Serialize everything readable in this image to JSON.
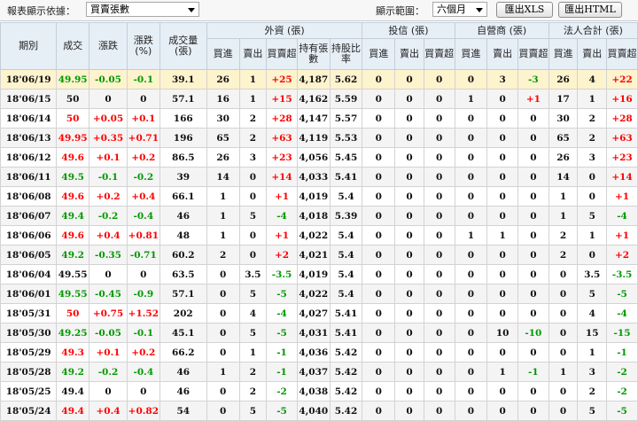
{
  "toolbar": {
    "display_basis_label": "報表顯示依據：",
    "display_basis_value": "買賣張數",
    "range_label": "顯示範圍：",
    "range_value": "六個月",
    "export_xls_label": "匯出XLS",
    "export_html_label": "匯出HTML"
  },
  "colors": {
    "up": "#ff0000",
    "down": "#009900",
    "highlight_row": "#fdf3cd",
    "header_bg": "#e6eef6"
  },
  "table": {
    "headers": {
      "date": "期別",
      "close": "成交",
      "change": "漲跌",
      "change_pct": "漲跌(%)",
      "volume": "成交量(張)",
      "foreign": "外資 (張)",
      "trust": "投信 (張)",
      "dealer": "自營商 (張)",
      "total": "法人合計 (張)",
      "buy": "買進",
      "sell": "賣出",
      "net": "買賣超",
      "holding": "持有張數",
      "ratio": "持股比率"
    },
    "rows": [
      {
        "date": "18'06/19",
        "close": "49.95",
        "change": "-0.05",
        "pct": "-0.1",
        "vol": "39.1",
        "f_buy": "26",
        "f_sell": "1",
        "f_net": "+25",
        "f_hold": "4,187",
        "f_ratio": "5.62",
        "t_buy": "0",
        "t_sell": "0",
        "t_net": "0",
        "d_buy": "0",
        "d_sell": "3",
        "d_net": "-3",
        "s_buy": "26",
        "s_sell": "4",
        "s_net": "+22"
      },
      {
        "date": "18'06/15",
        "close": "50",
        "change": "0",
        "pct": "0",
        "vol": "57.1",
        "f_buy": "16",
        "f_sell": "1",
        "f_net": "+15",
        "f_hold": "4,162",
        "f_ratio": "5.59",
        "t_buy": "0",
        "t_sell": "0",
        "t_net": "0",
        "d_buy": "1",
        "d_sell": "0",
        "d_net": "+1",
        "s_buy": "17",
        "s_sell": "1",
        "s_net": "+16"
      },
      {
        "date": "18'06/14",
        "close": "50",
        "change": "+0.05",
        "pct": "+0.1",
        "vol": "166",
        "f_buy": "30",
        "f_sell": "2",
        "f_net": "+28",
        "f_hold": "4,147",
        "f_ratio": "5.57",
        "t_buy": "0",
        "t_sell": "0",
        "t_net": "0",
        "d_buy": "0",
        "d_sell": "0",
        "d_net": "0",
        "s_buy": "30",
        "s_sell": "2",
        "s_net": "+28"
      },
      {
        "date": "18'06/13",
        "close": "49.95",
        "change": "+0.35",
        "pct": "+0.71",
        "vol": "196",
        "f_buy": "65",
        "f_sell": "2",
        "f_net": "+63",
        "f_hold": "4,119",
        "f_ratio": "5.53",
        "t_buy": "0",
        "t_sell": "0",
        "t_net": "0",
        "d_buy": "0",
        "d_sell": "0",
        "d_net": "0",
        "s_buy": "65",
        "s_sell": "2",
        "s_net": "+63"
      },
      {
        "date": "18'06/12",
        "close": "49.6",
        "change": "+0.1",
        "pct": "+0.2",
        "vol": "86.5",
        "f_buy": "26",
        "f_sell": "3",
        "f_net": "+23",
        "f_hold": "4,056",
        "f_ratio": "5.45",
        "t_buy": "0",
        "t_sell": "0",
        "t_net": "0",
        "d_buy": "0",
        "d_sell": "0",
        "d_net": "0",
        "s_buy": "26",
        "s_sell": "3",
        "s_net": "+23"
      },
      {
        "date": "18'06/11",
        "close": "49.5",
        "change": "-0.1",
        "pct": "-0.2",
        "vol": "39",
        "f_buy": "14",
        "f_sell": "0",
        "f_net": "+14",
        "f_hold": "4,033",
        "f_ratio": "5.41",
        "t_buy": "0",
        "t_sell": "0",
        "t_net": "0",
        "d_buy": "0",
        "d_sell": "0",
        "d_net": "0",
        "s_buy": "14",
        "s_sell": "0",
        "s_net": "+14"
      },
      {
        "date": "18'06/08",
        "close": "49.6",
        "change": "+0.2",
        "pct": "+0.4",
        "vol": "66.1",
        "f_buy": "1",
        "f_sell": "0",
        "f_net": "+1",
        "f_hold": "4,019",
        "f_ratio": "5.4",
        "t_buy": "0",
        "t_sell": "0",
        "t_net": "0",
        "d_buy": "0",
        "d_sell": "0",
        "d_net": "0",
        "s_buy": "1",
        "s_sell": "0",
        "s_net": "+1"
      },
      {
        "date": "18'06/07",
        "close": "49.4",
        "change": "-0.2",
        "pct": "-0.4",
        "vol": "46",
        "f_buy": "1",
        "f_sell": "5",
        "f_net": "-4",
        "f_hold": "4,018",
        "f_ratio": "5.39",
        "t_buy": "0",
        "t_sell": "0",
        "t_net": "0",
        "d_buy": "0",
        "d_sell": "0",
        "d_net": "0",
        "s_buy": "1",
        "s_sell": "5",
        "s_net": "-4"
      },
      {
        "date": "18'06/06",
        "close": "49.6",
        "change": "+0.4",
        "pct": "+0.81",
        "vol": "48",
        "f_buy": "1",
        "f_sell": "0",
        "f_net": "+1",
        "f_hold": "4,022",
        "f_ratio": "5.4",
        "t_buy": "0",
        "t_sell": "0",
        "t_net": "0",
        "d_buy": "1",
        "d_sell": "1",
        "d_net": "0",
        "s_buy": "2",
        "s_sell": "1",
        "s_net": "+1"
      },
      {
        "date": "18'06/05",
        "close": "49.2",
        "change": "-0.35",
        "pct": "-0.71",
        "vol": "60.2",
        "f_buy": "2",
        "f_sell": "0",
        "f_net": "+2",
        "f_hold": "4,021",
        "f_ratio": "5.4",
        "t_buy": "0",
        "t_sell": "0",
        "t_net": "0",
        "d_buy": "0",
        "d_sell": "0",
        "d_net": "0",
        "s_buy": "2",
        "s_sell": "0",
        "s_net": "+2"
      },
      {
        "date": "18'06/04",
        "close": "49.55",
        "change": "0",
        "pct": "0",
        "vol": "63.5",
        "f_buy": "0",
        "f_sell": "3.5",
        "f_net": "-3.5",
        "f_hold": "4,019",
        "f_ratio": "5.4",
        "t_buy": "0",
        "t_sell": "0",
        "t_net": "0",
        "d_buy": "0",
        "d_sell": "0",
        "d_net": "0",
        "s_buy": "0",
        "s_sell": "3.5",
        "s_net": "-3.5"
      },
      {
        "date": "18'06/01",
        "close": "49.55",
        "change": "-0.45",
        "pct": "-0.9",
        "vol": "57.1",
        "f_buy": "0",
        "f_sell": "5",
        "f_net": "-5",
        "f_hold": "4,022",
        "f_ratio": "5.4",
        "t_buy": "0",
        "t_sell": "0",
        "t_net": "0",
        "d_buy": "0",
        "d_sell": "0",
        "d_net": "0",
        "s_buy": "0",
        "s_sell": "5",
        "s_net": "-5"
      },
      {
        "date": "18'05/31",
        "close": "50",
        "change": "+0.75",
        "pct": "+1.52",
        "vol": "202",
        "f_buy": "0",
        "f_sell": "4",
        "f_net": "-4",
        "f_hold": "4,027",
        "f_ratio": "5.41",
        "t_buy": "0",
        "t_sell": "0",
        "t_net": "0",
        "d_buy": "0",
        "d_sell": "0",
        "d_net": "0",
        "s_buy": "0",
        "s_sell": "4",
        "s_net": "-4"
      },
      {
        "date": "18'05/30",
        "close": "49.25",
        "change": "-0.05",
        "pct": "-0.1",
        "vol": "45.1",
        "f_buy": "0",
        "f_sell": "5",
        "f_net": "-5",
        "f_hold": "4,031",
        "f_ratio": "5.41",
        "t_buy": "0",
        "t_sell": "0",
        "t_net": "0",
        "d_buy": "0",
        "d_sell": "10",
        "d_net": "-10",
        "s_buy": "0",
        "s_sell": "15",
        "s_net": "-15"
      },
      {
        "date": "18'05/29",
        "close": "49.3",
        "change": "+0.1",
        "pct": "+0.2",
        "vol": "66.2",
        "f_buy": "0",
        "f_sell": "1",
        "f_net": "-1",
        "f_hold": "4,036",
        "f_ratio": "5.42",
        "t_buy": "0",
        "t_sell": "0",
        "t_net": "0",
        "d_buy": "0",
        "d_sell": "0",
        "d_net": "0",
        "s_buy": "0",
        "s_sell": "1",
        "s_net": "-1"
      },
      {
        "date": "18'05/28",
        "close": "49.2",
        "change": "-0.2",
        "pct": "-0.4",
        "vol": "46",
        "f_buy": "1",
        "f_sell": "2",
        "f_net": "-1",
        "f_hold": "4,037",
        "f_ratio": "5.42",
        "t_buy": "0",
        "t_sell": "0",
        "t_net": "0",
        "d_buy": "0",
        "d_sell": "1",
        "d_net": "-1",
        "s_buy": "1",
        "s_sell": "3",
        "s_net": "-2"
      },
      {
        "date": "18'05/25",
        "close": "49.4",
        "change": "0",
        "pct": "0",
        "vol": "46",
        "f_buy": "0",
        "f_sell": "2",
        "f_net": "-2",
        "f_hold": "4,038",
        "f_ratio": "5.42",
        "t_buy": "0",
        "t_sell": "0",
        "t_net": "0",
        "d_buy": "0",
        "d_sell": "0",
        "d_net": "0",
        "s_buy": "0",
        "s_sell": "2",
        "s_net": "-2"
      },
      {
        "date": "18'05/24",
        "close": "49.4",
        "change": "+0.4",
        "pct": "+0.82",
        "vol": "54",
        "f_buy": "0",
        "f_sell": "5",
        "f_net": "-5",
        "f_hold": "4,040",
        "f_ratio": "5.42",
        "t_buy": "0",
        "t_sell": "0",
        "t_net": "0",
        "d_buy": "0",
        "d_sell": "0",
        "d_net": "0",
        "s_buy": "0",
        "s_sell": "5",
        "s_net": "-5"
      }
    ]
  }
}
